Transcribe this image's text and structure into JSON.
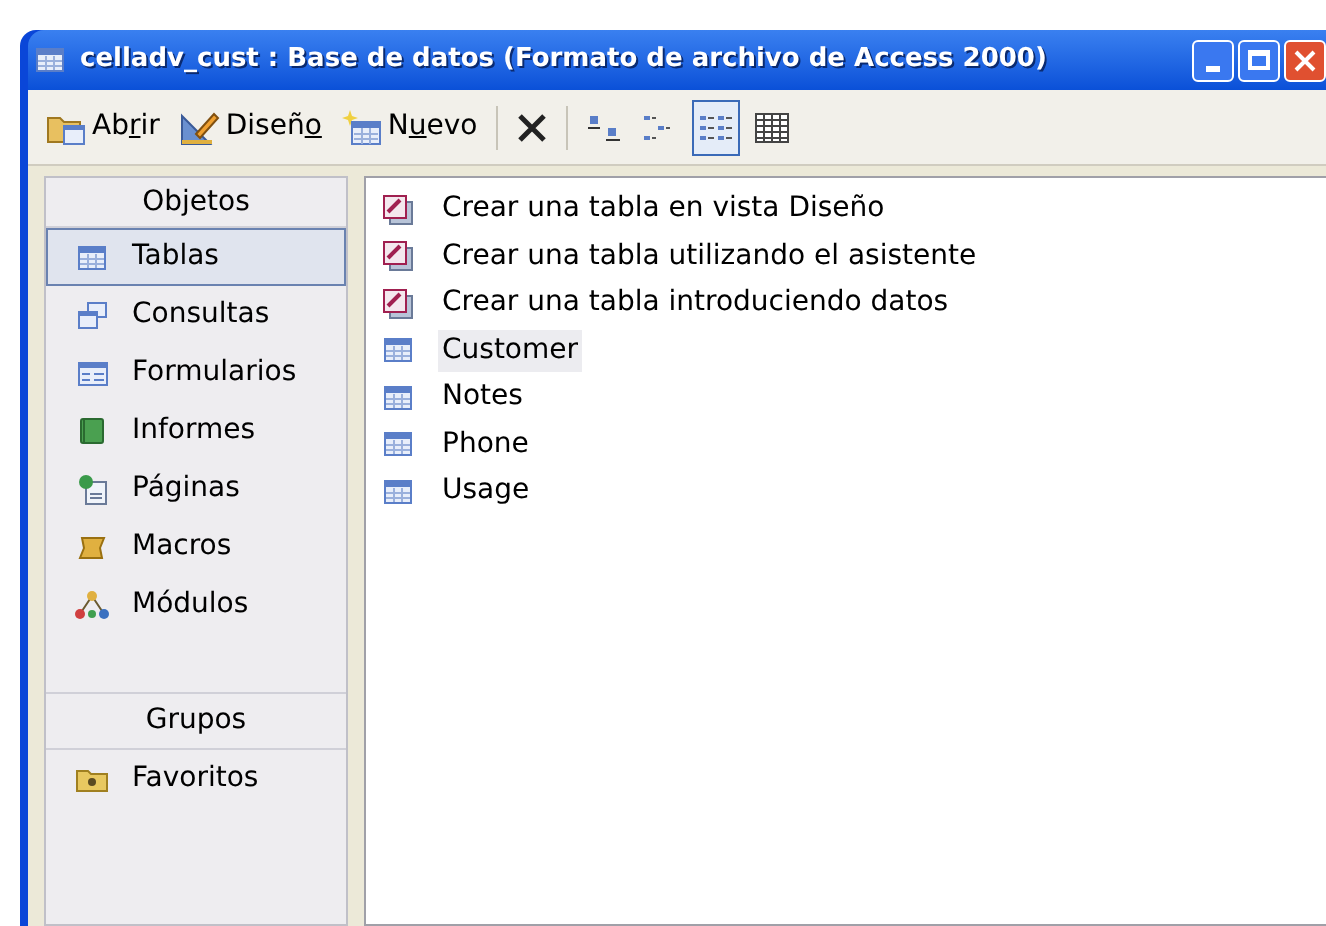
{
  "window": {
    "title": "celladv_cust : Base de datos (Formato de archivo de Access 2000)"
  },
  "toolbar": [
    {
      "kind": "open",
      "label": {
        "before": "Ab",
        "key": "r",
        "after": "ir"
      }
    },
    {
      "kind": "design",
      "label": {
        "before": "Diseñ",
        "key": "o"
      }
    },
    {
      "kind": "new",
      "label": {
        "before": "N",
        "key": "u",
        "after": "evo"
      }
    },
    {
      "kind": "delete"
    },
    {
      "kind": "large-icons",
      "selected": false
    },
    {
      "kind": "small-icons",
      "selected": false
    },
    {
      "kind": "list",
      "selected": true
    },
    {
      "kind": "details",
      "selected": false
    }
  ],
  "sidebar": {
    "objects_header": "Objetos",
    "items": [
      {
        "label": "Tablas",
        "kind": "tables",
        "selected": true
      },
      {
        "label": "Consultas",
        "kind": "queries",
        "selected": false
      },
      {
        "label": "Formularios",
        "kind": "forms",
        "selected": false
      },
      {
        "label": "Informes",
        "kind": "reports",
        "selected": false
      },
      {
        "label": "Páginas",
        "kind": "pages",
        "selected": false
      },
      {
        "label": "Macros",
        "kind": "macros",
        "selected": false
      },
      {
        "label": "Módulos",
        "kind": "modules",
        "selected": false
      }
    ],
    "groups_header": "Grupos",
    "groups": [
      {
        "label": "Favoritos",
        "selected": false
      }
    ]
  },
  "objects": [
    {
      "label": "Crear una tabla en vista Diseño",
      "kind": "wizard",
      "selected": false
    },
    {
      "label": "Crear una tabla utilizando el asistente",
      "kind": "wizard",
      "selected": false
    },
    {
      "label": "Crear una tabla introduciendo datos",
      "kind": "wizard",
      "selected": false
    },
    {
      "label": "Customer",
      "kind": "table",
      "selected": true
    },
    {
      "label": "Notes",
      "kind": "table",
      "selected": false
    },
    {
      "label": "Phone",
      "kind": "table",
      "selected": false
    },
    {
      "label": "Usage",
      "kind": "table",
      "selected": false
    }
  ]
}
